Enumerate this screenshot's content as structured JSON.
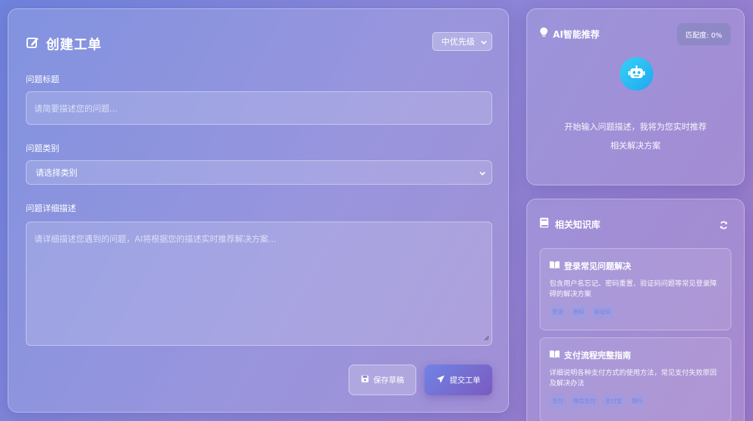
{
  "form": {
    "title": "创建工单",
    "priority": "中优先级",
    "title_label": "问题标题",
    "title_placeholder": "请简要描述您的问题...",
    "category_label": "问题类别",
    "category_value": "请选择类别",
    "desc_label": "问题详细描述",
    "desc_placeholder": "请详细描述您遇到的问题，AI将根据您的描述实时推荐解决方案...",
    "save_label": "保存草稿",
    "submit_label": "提交工单"
  },
  "ai": {
    "title": "AI智能推荐",
    "match": "匹配度: 0%",
    "hint_line1": "开始输入问题描述，我将为您实时推荐",
    "hint_line2": "相关解决方案"
  },
  "kb": {
    "title": "相关知识库",
    "items": [
      {
        "title": "登录常见问题解决",
        "desc": "包含用户名忘记、密码重置、验证码问题等常见登录障碍的解决方案",
        "tags": [
          "登录",
          "密码",
          "验证码"
        ]
      },
      {
        "title": "支付流程完整指南",
        "desc": "详细说明各种支付方式的使用方法，常见支付失败原因及解决办法",
        "tags": [
          "支付",
          "微信支付",
          "支付宝",
          "银行"
        ]
      }
    ]
  },
  "colors": {
    "accent": "#7183e6",
    "robot": "#36d1f5"
  }
}
